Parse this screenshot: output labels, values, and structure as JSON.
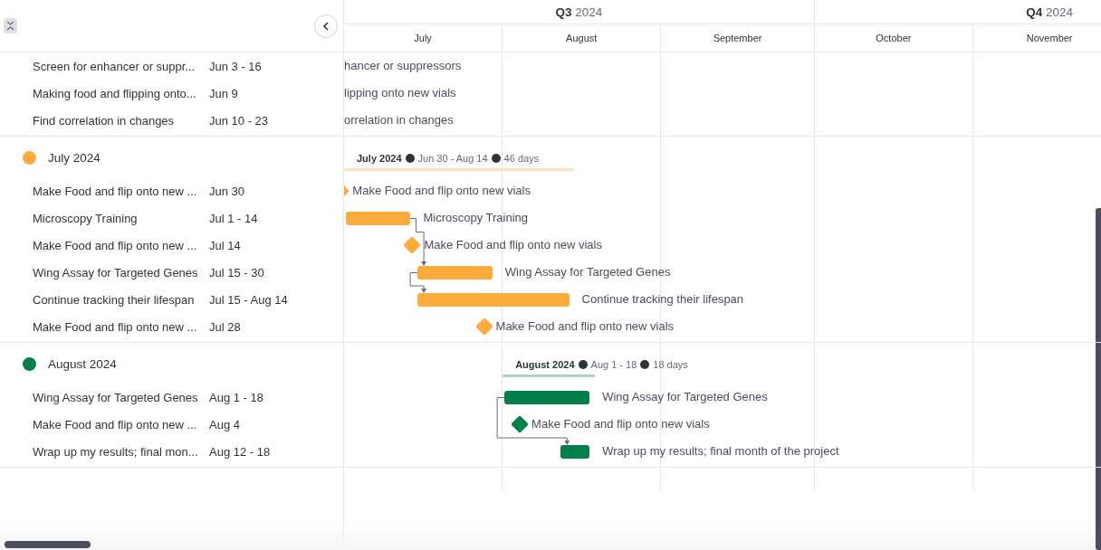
{
  "timeline_header": {
    "quarters": [
      {
        "label": "**Q3** 2024"
      },
      {
        "label": "**Q4** 2024"
      }
    ],
    "months": [
      "July",
      "August",
      "September",
      "October",
      "November"
    ]
  },
  "sections": [
    {
      "tasks": [
        {
          "name": "Screen for enhancer or suppr...",
          "dates": "Jun 3 - 16",
          "kind": "task",
          "bar_label": "hancer or suppressors"
        },
        {
          "name": "Making food and flipping onto...",
          "dates": "Jun 9",
          "kind": "milestone",
          "bar_label": "lipping onto new vials"
        },
        {
          "name": "Find correlation in changes",
          "dates": "Jun 10 - 23",
          "kind": "task",
          "bar_label": "orrelation in changes"
        }
      ]
    },
    {
      "title": "July 2024",
      "color": "#fdab3d",
      "summary": {
        "name": "July 2024",
        "dates": "Jun 30 - Aug 14",
        "duration": "46 days"
      },
      "tasks": [
        {
          "name": "Make Food and flip onto new ...",
          "dates": "Jun 30",
          "kind": "milestone",
          "bar_label": "Make Food and flip onto new vials"
        },
        {
          "name": "Microscopy Training",
          "dates": "Jul 1 - 14",
          "kind": "task",
          "bar_label": "Microscopy Training",
          "links_from_end": true
        },
        {
          "name": "Make Food and flip onto new ...",
          "dates": "Jul 14",
          "kind": "milestone",
          "bar_label": "Make Food and flip onto new vials"
        },
        {
          "name": "Wing Assay for Targeted Genes",
          "dates": "Jul 15 - 30",
          "kind": "task",
          "bar_label": "Wing Assay for Targeted Genes",
          "links_from_start": true
        },
        {
          "name": "Continue tracking their lifespan",
          "dates": "Jul 15 - Aug 14",
          "kind": "task",
          "bar_label": "Continue tracking their lifespan"
        },
        {
          "name": "Make Food and flip onto new ...",
          "dates": "Jul 28",
          "kind": "milestone",
          "bar_label": "Make Food and flip onto new vials"
        }
      ]
    },
    {
      "title": "August 2024",
      "color": "#037f4c",
      "summary": {
        "name": "August 2024",
        "dates": "Aug 1 - 18",
        "duration": "18 days"
      },
      "tasks": [
        {
          "name": "Wing Assay for Targeted Genes",
          "dates": "Aug 1 - 18",
          "kind": "task",
          "bar_label": "Wing Assay for Targeted Genes",
          "links_from_start": true
        },
        {
          "name": "Make Food and flip onto new ...",
          "dates": "Aug 4",
          "kind": "milestone",
          "bar_label": "Make Food and flip onto new vials"
        },
        {
          "name": "Wrap up my results; final mon...",
          "dates": "Aug 12 - 18",
          "kind": "task",
          "bar_label": "Wrap up my results; final month of the project"
        }
      ]
    }
  ]
}
